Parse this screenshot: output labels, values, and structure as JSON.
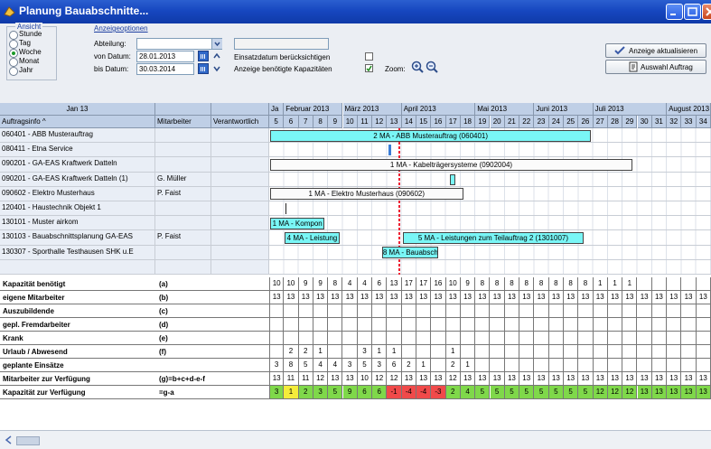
{
  "window": {
    "title": "Planung Bauabschnitte..."
  },
  "view": {
    "group_label": "Ansicht",
    "options": [
      "Stunde",
      "Tag",
      "Woche",
      "Monat",
      "Jahr"
    ],
    "selected": "Woche"
  },
  "display_options": {
    "label": "Anzeigeoptionen",
    "abteilung_label": "Abteilung:",
    "abteilung_value": "",
    "von_label": "von Datum:",
    "von_value": "28.01.2013",
    "bis_label": "bis Datum:",
    "bis_value": "30.03.2014",
    "einsatz_label": "Einsatzdatum berücksichtigen",
    "einsatz_checked": false,
    "kapaz_label": "Anzeige benötigte Kapazitäten",
    "kapaz_checked": true,
    "zoom_label": "Zoom:"
  },
  "buttons": {
    "refresh": "Anzeige aktualisieren",
    "select_order": "Auswahl Auftrag"
  },
  "grid": {
    "top_left": "Jan 13",
    "months": [
      "Ja",
      "Februar 2013",
      "März 2013",
      "April 2013",
      "Mai 2013",
      "Juni 2013",
      "Juli 2013",
      "August 2013"
    ],
    "col_headers": {
      "auftrag": "Auftragsinfo ^",
      "mitarbeiter": "Mitarbeiter",
      "verantwortlich": "Verantwortlich"
    },
    "weeks": [
      "5",
      "6",
      "7",
      "8",
      "9",
      "10",
      "11",
      "12",
      "13",
      "14",
      "15",
      "16",
      "17",
      "18",
      "19",
      "20",
      "21",
      "22",
      "23",
      "24",
      "25",
      "26",
      "27",
      "28",
      "29",
      "30",
      "31",
      "32",
      "33",
      "34"
    ],
    "rows": [
      {
        "auftrag": "060401 - ABB Musterauftrag",
        "mitarbeiter": "",
        "verantwortlich": ""
      },
      {
        "auftrag": "080411 - Etna Service",
        "mitarbeiter": "",
        "verantwortlich": ""
      },
      {
        "auftrag": "090201 - GA-EAS Kraftwerk Datteln",
        "mitarbeiter": "",
        "verantwortlich": ""
      },
      {
        "auftrag": "090201 - GA-EAS Kraftwerk Datteln (1)",
        "mitarbeiter": "G. Müller",
        "verantwortlich": ""
      },
      {
        "auftrag": "090602 - Elektro Musterhaus",
        "mitarbeiter": "P. Faist",
        "verantwortlich": ""
      },
      {
        "auftrag": "120401 - Haustechnik Objekt 1",
        "mitarbeiter": "",
        "verantwortlich": ""
      },
      {
        "auftrag": "130101 - Muster airkom",
        "mitarbeiter": "",
        "verantwortlich": ""
      },
      {
        "auftrag": "130103 - Bauabschnittsplanung GA-EAS",
        "mitarbeiter": "P. Faist",
        "verantwortlich": ""
      },
      {
        "auftrag": "130307 - Sporthalle Testhausen SHK u.E",
        "mitarbeiter": "",
        "verantwortlich": ""
      },
      {
        "auftrag": "",
        "mitarbeiter": "",
        "verantwortlich": ""
      }
    ],
    "bars": [
      {
        "text": "2 MA - ABB Musterauftrag (060401)"
      },
      {
        "text": "1 MA - Kabelträgersysteme (0902004)"
      },
      {
        "text": "1 MA - Elektro Musterhaus (090602)"
      },
      {
        "text": "1 MA - Kompon"
      },
      {
        "text": "4 MA - Leistung"
      },
      {
        "text": "5 MA - Leistungen zum Teilauftrag 2 (1301007)"
      },
      {
        "text": "8 MA - Bauabsch"
      }
    ],
    "capacity": [
      {
        "label": "Kapazität benötigt",
        "formula": "(a)",
        "values": [
          "10",
          "10",
          "9",
          "9",
          "8",
          "4",
          "4",
          "6",
          "13",
          "17",
          "17",
          "16",
          "10",
          "9",
          "8",
          "8",
          "8",
          "8",
          "8",
          "8",
          "8",
          "8",
          "1",
          "1",
          "1",
          "",
          "",
          "",
          "",
          ""
        ]
      },
      {
        "label": "eigene Mitarbeiter",
        "formula": "(b)",
        "values": [
          "13",
          "13",
          "13",
          "13",
          "13",
          "13",
          "13",
          "13",
          "13",
          "13",
          "13",
          "13",
          "13",
          "13",
          "13",
          "13",
          "13",
          "13",
          "13",
          "13",
          "13",
          "13",
          "13",
          "13",
          "13",
          "13",
          "13",
          "13",
          "13",
          "13"
        ]
      },
      {
        "label": "Auszubildende",
        "formula": "(c)",
        "values": [
          "",
          "",
          "",
          "",
          "",
          "",
          "",
          "",
          "",
          "",
          "",
          "",
          "",
          "",
          "",
          "",
          "",
          "",
          "",
          "",
          "",
          "",
          "",
          "",
          "",
          "",
          "",
          "",
          "",
          ""
        ]
      },
      {
        "label": "gepl. Fremdarbeiter",
        "formula": "(d)",
        "values": [
          "",
          "",
          "",
          "",
          "",
          "",
          "",
          "",
          "",
          "",
          "",
          "",
          "",
          "",
          "",
          "",
          "",
          "",
          "",
          "",
          "",
          "",
          "",
          "",
          "",
          "",
          "",
          "",
          "",
          ""
        ]
      },
      {
        "label": "Krank",
        "formula": "(e)",
        "values": [
          "",
          "",
          "",
          "",
          "",
          "",
          "",
          "",
          "",
          "",
          "",
          "",
          "",
          "",
          "",
          "",
          "",
          "",
          "",
          "",
          "",
          "",
          "",
          "",
          "",
          "",
          "",
          "",
          "",
          ""
        ]
      },
      {
        "label": "Urlaub / Abwesend",
        "formula": "(f)",
        "values": [
          "",
          "2",
          "2",
          "1",
          "",
          "",
          "3",
          "1",
          "1",
          "",
          "",
          "",
          "1",
          "",
          "",
          "",
          "",
          "",
          "",
          "",
          "",
          "",
          "",
          "",
          "",
          "",
          "",
          "",
          "",
          ""
        ]
      },
      {
        "label": "geplante Einsätze",
        "formula": "",
        "values": [
          "3",
          "8",
          "5",
          "4",
          "4",
          "3",
          "5",
          "3",
          "6",
          "2",
          "1",
          "",
          "2",
          "1",
          "",
          "",
          "",
          "",
          "",
          "",
          "",
          "",
          "",
          "",
          "",
          "",
          "",
          "",
          "",
          ""
        ]
      },
      {
        "label": "Mitarbeiter zur Verfügung",
        "formula": "(g)=b+c+d-e-f",
        "values": [
          "13",
          "11",
          "11",
          "12",
          "13",
          "13",
          "10",
          "12",
          "12",
          "13",
          "13",
          "13",
          "12",
          "13",
          "13",
          "13",
          "13",
          "13",
          "13",
          "13",
          "13",
          "13",
          "13",
          "13",
          "13",
          "13",
          "13",
          "13",
          "13",
          "13"
        ]
      },
      {
        "label": "Kapazität zur Verfügung",
        "formula": "=g-a",
        "values": [
          "3",
          "1",
          "2",
          "3",
          "5",
          "9",
          "6",
          "6",
          "-1",
          "-4",
          "-4",
          "-3",
          "2",
          "4",
          "5",
          "5",
          "5",
          "5",
          "5",
          "5",
          "5",
          "5",
          "12",
          "12",
          "12",
          "13",
          "13",
          "13",
          "13",
          "13"
        ]
      }
    ],
    "colors": {
      "positive": "#7fd84a",
      "warning": "#f4ec3a",
      "negative": "#f04a4a",
      "bar": "#79f6f6"
    }
  }
}
